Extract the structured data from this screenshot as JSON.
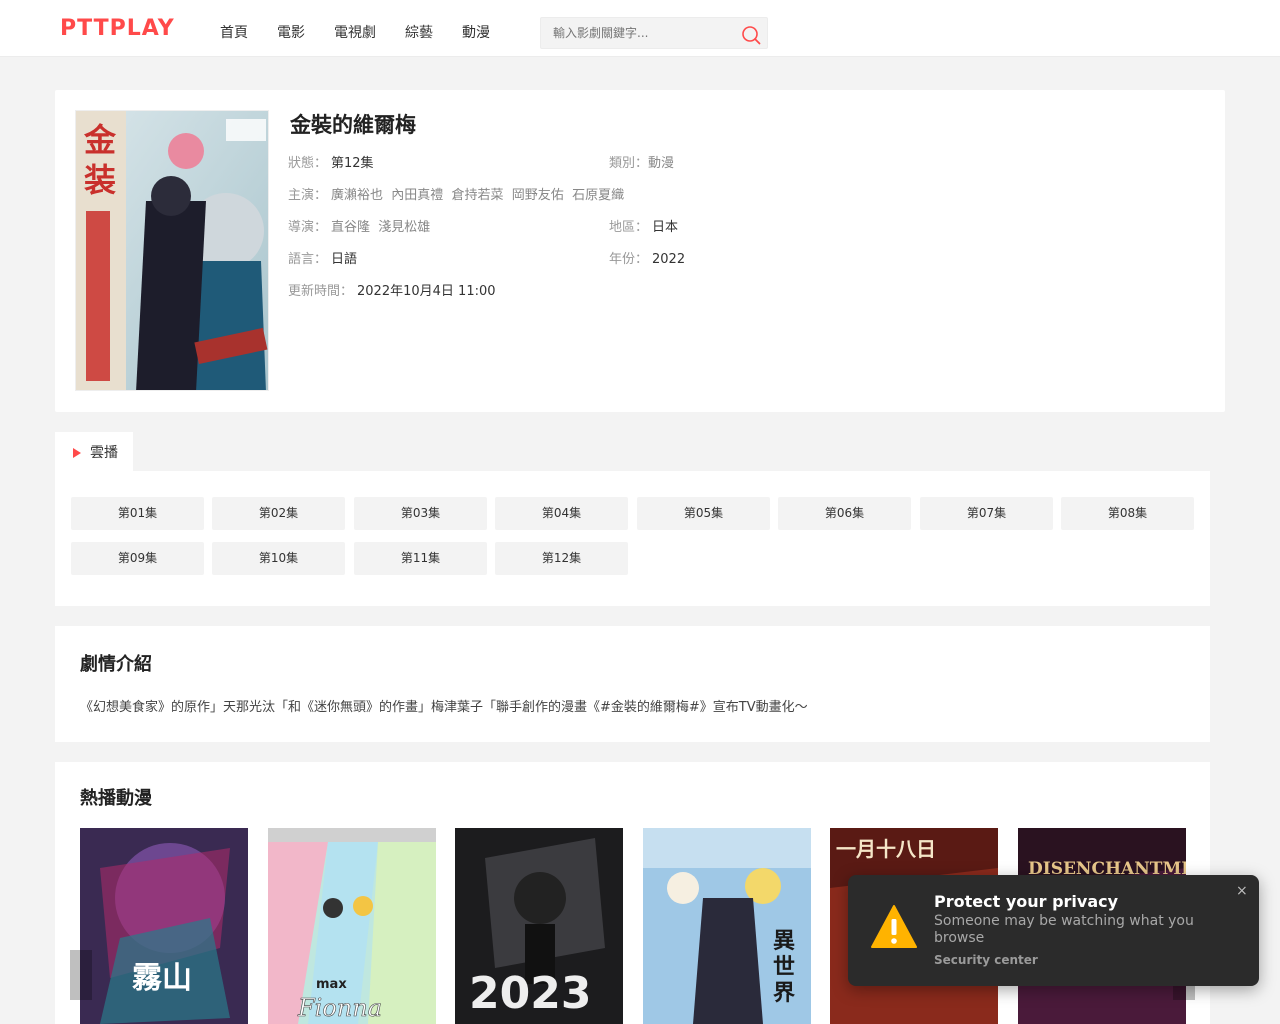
{
  "header": {
    "logo": "PTTPLAY",
    "nav": [
      "首頁",
      "電影",
      "電視劇",
      "綜藝",
      "動漫"
    ],
    "search_placeholder": "輸入影劇關鍵字..."
  },
  "detail": {
    "title": "金裝的維爾梅",
    "status_label": "狀態：",
    "status": "第12集",
    "category_label": "類別：",
    "category": "動漫",
    "cast_label": "主演：",
    "cast": "廣瀨裕也  內田真禮  倉持若菜  岡野友佑  石原夏織",
    "director_label": "導演：",
    "director": "直谷隆  淺見松雄",
    "region_label": "地區：",
    "region": "日本",
    "language_label": "語言：",
    "language": "日語",
    "year_label": "年份：",
    "year": "2022",
    "updated_label": "更新時間：",
    "updated": "2022年10月4日 11:00"
  },
  "source_tab": "雲播",
  "episodes": [
    "第01集",
    "第02集",
    "第03集",
    "第04集",
    "第05集",
    "第06集",
    "第07集",
    "第08集",
    "第09集",
    "第10集",
    "第11集",
    "第12集"
  ],
  "synopsis": {
    "title": "劇情介紹",
    "text": "《幻想美食家》的原作」天那光汰「和《迷你無頭》的作畫」梅津葉子「聯手創作的漫畫《#金裝的維爾梅#》宣布TV動畫化～"
  },
  "hot": {
    "title": "熱播動漫"
  },
  "toast": {
    "title": "Protect your privacy",
    "body": "Someone may be watching what you browse",
    "source": "Security center",
    "close": "×"
  },
  "colors": {
    "accent": "#ff4a4a",
    "page_bg": "#f3f3f3",
    "toast_bg": "#2b2b2b",
    "warning": "#ffb300"
  }
}
